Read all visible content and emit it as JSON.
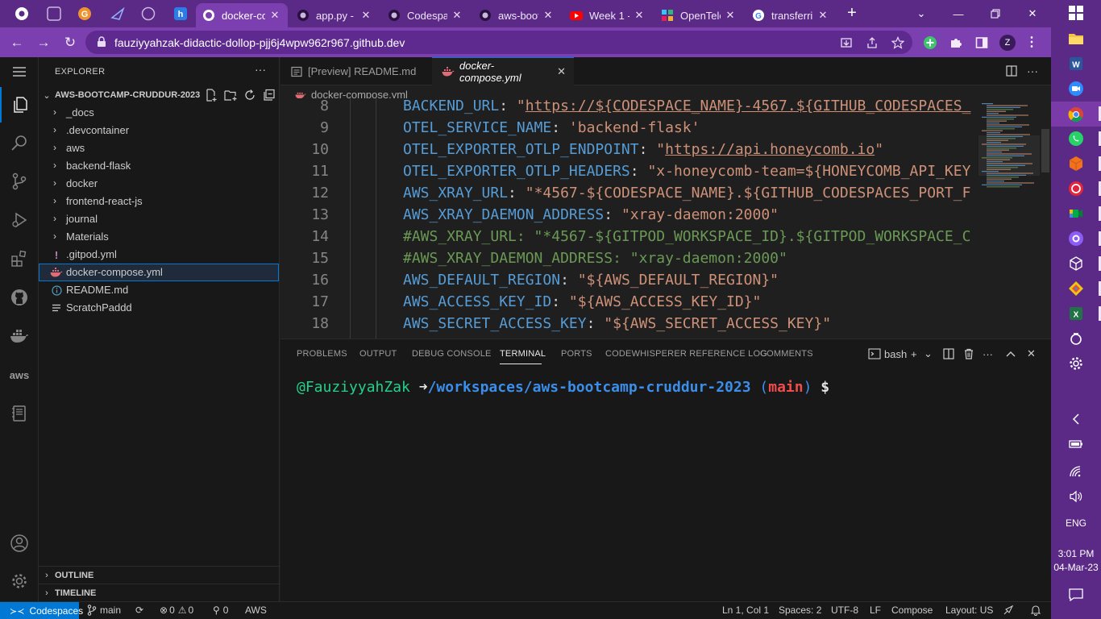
{
  "browser": {
    "tabs": [
      {
        "title": "docker-co",
        "favicon": "github-icon",
        "active": true
      },
      {
        "title": "app.py - /",
        "favicon": "github-icon",
        "active": false
      },
      {
        "title": "Codespa",
        "favicon": "github-icon",
        "active": false
      },
      {
        "title": "aws-boot",
        "favicon": "github-icon",
        "active": false
      },
      {
        "title": "Week 1 -",
        "favicon": "youtube-icon",
        "active": false
      },
      {
        "title": "OpenTele",
        "favicon": "slack-icon",
        "active": false
      },
      {
        "title": "transferri",
        "favicon": "google-icon",
        "active": false
      }
    ],
    "url": "fauziyyahzak-didactic-dollop-pjj6j4wpw962r967.github.dev",
    "profile_initial": "Z"
  },
  "explorer": {
    "title": "EXPLORER",
    "more": "···",
    "root_folder": "AWS-BOOTCAMP-CRUDDUR-2023",
    "items": [
      {
        "label": "_docs",
        "kind": "folder"
      },
      {
        "label": ".devcontainer",
        "kind": "folder"
      },
      {
        "label": "aws",
        "kind": "folder"
      },
      {
        "label": "backend-flask",
        "kind": "folder"
      },
      {
        "label": "docker",
        "kind": "folder"
      },
      {
        "label": "frontend-react-js",
        "kind": "folder"
      },
      {
        "label": "journal",
        "kind": "folder"
      },
      {
        "label": "Materials",
        "kind": "folder"
      },
      {
        "label": ".gitpod.yml",
        "kind": "yaml"
      },
      {
        "label": "docker-compose.yml",
        "kind": "docker",
        "selected": true
      },
      {
        "label": "README.md",
        "kind": "info"
      },
      {
        "label": "ScratchPaddd",
        "kind": "text"
      }
    ],
    "outline": "OUTLINE",
    "timeline": "TIMELINE"
  },
  "editor": {
    "tabs": [
      {
        "title": "[Preview] README.md",
        "active": false
      },
      {
        "title": "docker-compose.yml",
        "active": true
      }
    ],
    "breadcrumb": "docker-compose.yml",
    "lines": [
      {
        "num": "8",
        "parts": [
          {
            "t": "BACKEND_URL",
            "c": "k"
          },
          {
            "t": ": ",
            "c": "p"
          },
          {
            "t": "\"",
            "c": "s"
          },
          {
            "t": "https://${CODESPACE_NAME}-4567.${GITHUB_CODESPACES_",
            "c": "s u"
          }
        ]
      },
      {
        "num": "9",
        "parts": [
          {
            "t": "OTEL_SERVICE_NAME",
            "c": "k"
          },
          {
            "t": ": ",
            "c": "p"
          },
          {
            "t": "'backend-flask'",
            "c": "s"
          }
        ]
      },
      {
        "num": "10",
        "parts": [
          {
            "t": "OTEL_EXPORTER_OTLP_ENDPOINT",
            "c": "k"
          },
          {
            "t": ": ",
            "c": "p"
          },
          {
            "t": "\"",
            "c": "s"
          },
          {
            "t": "https://api.honeycomb.io",
            "c": "s u"
          },
          {
            "t": "\"",
            "c": "s"
          }
        ]
      },
      {
        "num": "11",
        "parts": [
          {
            "t": "OTEL_EXPORTER_OTLP_HEADERS",
            "c": "k"
          },
          {
            "t": ": ",
            "c": "p"
          },
          {
            "t": "\"x-honeycomb-team=${HONEYCOMB_API_KEY",
            "c": "s"
          }
        ]
      },
      {
        "num": "12",
        "parts": [
          {
            "t": "AWS_XRAY_URL",
            "c": "k"
          },
          {
            "t": ": ",
            "c": "p"
          },
          {
            "t": "\"*4567-${CODESPACE_NAME}.${GITHUB_CODESPACES_PORT_F",
            "c": "s"
          }
        ]
      },
      {
        "num": "13",
        "parts": [
          {
            "t": "AWS_XRAY_DAEMON_ADDRESS",
            "c": "k"
          },
          {
            "t": ": ",
            "c": "p"
          },
          {
            "t": "\"xray-daemon:2000\"",
            "c": "s"
          }
        ]
      },
      {
        "num": "14",
        "parts": [
          {
            "t": "#AWS_XRAY_URL: \"*4567-${GITPOD_WORKSPACE_ID}.${GITPOD_WORKSPACE_C",
            "c": "c"
          }
        ]
      },
      {
        "num": "15",
        "parts": [
          {
            "t": "#AWS_XRAY_DAEMON_ADDRESS: \"xray-daemon:2000\"",
            "c": "c"
          }
        ]
      },
      {
        "num": "16",
        "parts": [
          {
            "t": "AWS_DEFAULT_REGION",
            "c": "k"
          },
          {
            "t": ": ",
            "c": "p"
          },
          {
            "t": "\"${AWS_DEFAULT_REGION}\"",
            "c": "s"
          }
        ]
      },
      {
        "num": "17",
        "parts": [
          {
            "t": "AWS_ACCESS_KEY_ID",
            "c": "k"
          },
          {
            "t": ": ",
            "c": "p"
          },
          {
            "t": "\"${AWS_ACCESS_KEY_ID}\"",
            "c": "s"
          }
        ]
      },
      {
        "num": "18",
        "parts": [
          {
            "t": "AWS_SECRET_ACCESS_KEY",
            "c": "k"
          },
          {
            "t": ": ",
            "c": "p"
          },
          {
            "t": "\"${AWS_SECRET_ACCESS_KEY}\"",
            "c": "s"
          }
        ]
      }
    ]
  },
  "panel": {
    "tabs": [
      "PROBLEMS",
      "OUTPUT",
      "DEBUG CONSOLE",
      "TERMINAL",
      "PORTS",
      "CODEWHISPERER REFERENCE LOG",
      "COMMENTS"
    ],
    "active_tab": "TERMINAL",
    "shell": "bash",
    "terminal": {
      "user": "@FauziyyahZak",
      "arrow": "➜",
      "path": "/workspaces/aws-bootcamp-cruddur-2023",
      "paren_open": "(",
      "branch": "main",
      "paren_close": ")",
      "prompt": "$"
    }
  },
  "statusbar": {
    "remote": "Codespaces",
    "branch": "main",
    "errors": "0",
    "warnings": "0",
    "ports": "0",
    "aws": "AWS",
    "position": "Ln 1, Col 1",
    "spaces": "Spaces: 2",
    "encoding": "UTF-8",
    "eol": "LF",
    "language": "Compose",
    "layout": "Layout: US"
  },
  "taskbar": {
    "lang": "ENG",
    "time": "3:01 PM",
    "date": "04-Mar-23"
  },
  "colors": {
    "accent": "#0078d4",
    "browser_frame": "#5b2a86",
    "browser_toolbar": "#7b3fb0"
  }
}
